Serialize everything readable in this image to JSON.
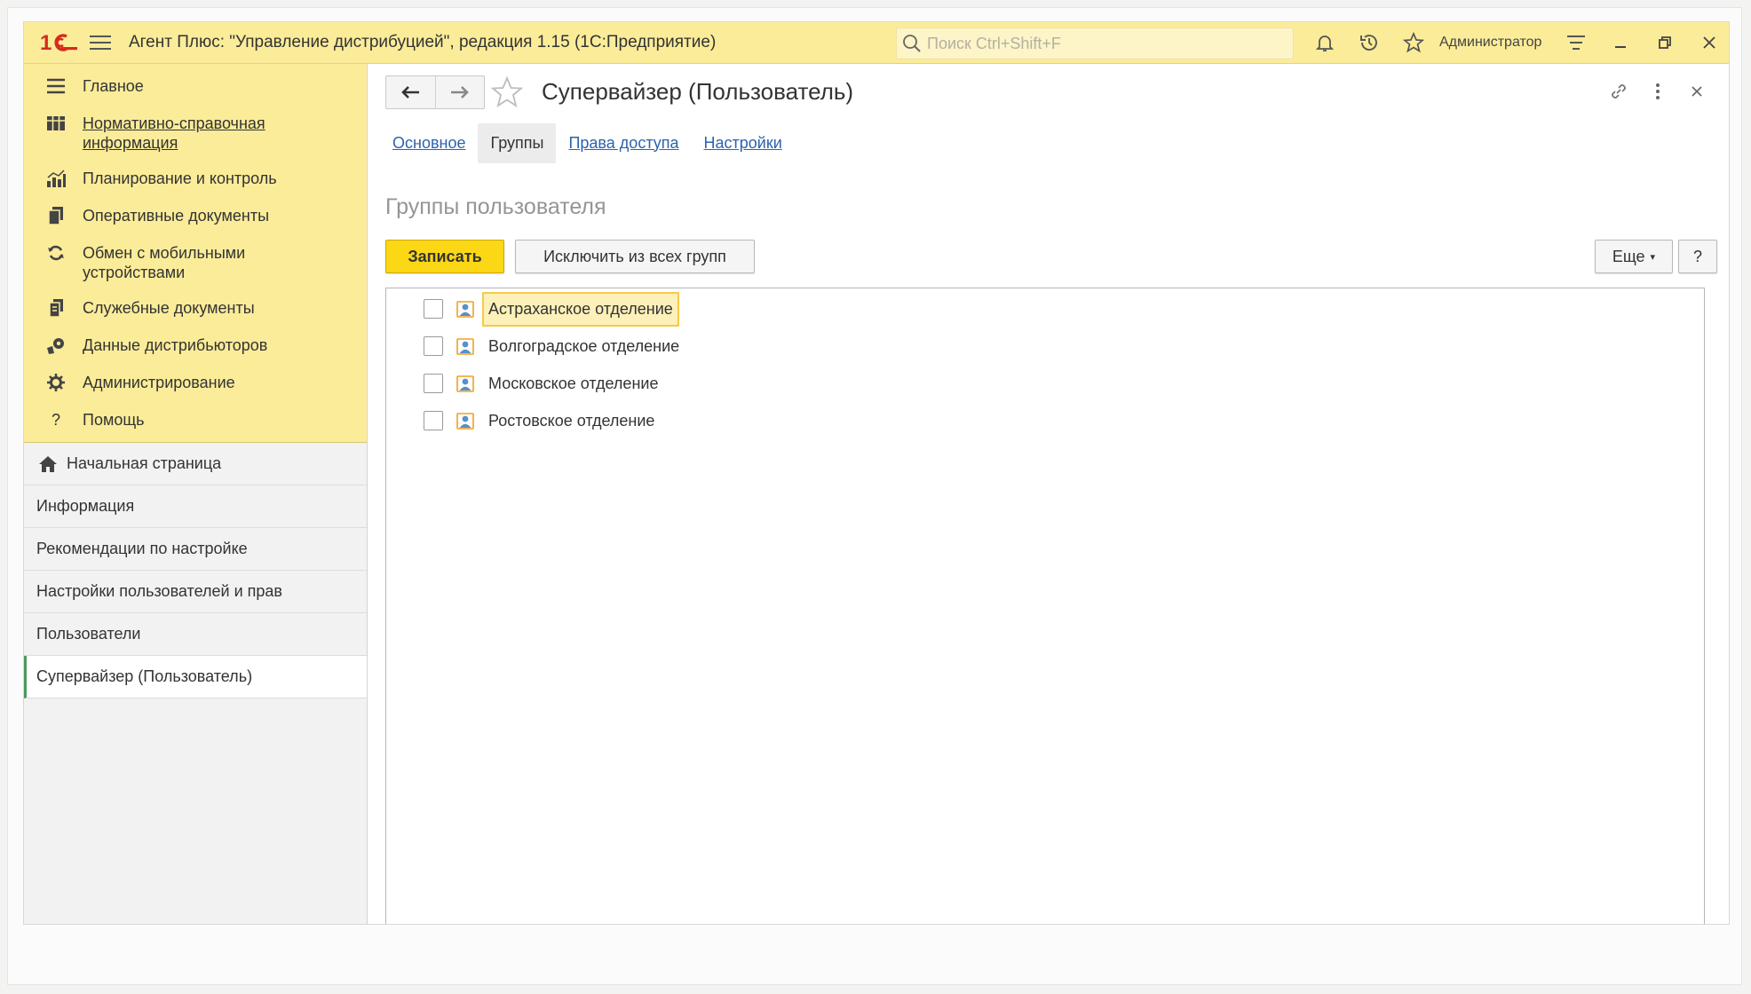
{
  "window": {
    "title": "Агент Плюс: \"Управление дистрибуцией\", редакция 1.15  (1С:Предприятие)",
    "search_placeholder": "Поиск Ctrl+Shift+F",
    "user": "Администратор"
  },
  "sidebar": {
    "sections": [
      {
        "label": "Главное",
        "icon": "hamburger-icon"
      },
      {
        "label": "Нормативно-справочная информация",
        "icon": "grid-icon"
      },
      {
        "label": "Планирование и контроль",
        "icon": "chart-icon"
      },
      {
        "label": "Оперативные документы",
        "icon": "documents-icon"
      },
      {
        "label": "Обмен с мобильными устройствами",
        "icon": "sync-icon"
      },
      {
        "label": "Служебные документы",
        "icon": "service-docs-icon"
      },
      {
        "label": "Данные дистрибьюторов",
        "icon": "distributor-icon"
      },
      {
        "label": "Администрирование",
        "icon": "gear-icon"
      },
      {
        "label": "Помощь",
        "icon": "question-icon"
      }
    ],
    "open_windows": [
      {
        "label": "Начальная страница"
      },
      {
        "label": "Информация"
      },
      {
        "label": "Рекомендации по настройке"
      },
      {
        "label": "Настройки пользователей и прав"
      },
      {
        "label": "Пользователи"
      },
      {
        "label": "Супервайзер (Пользователь)"
      }
    ]
  },
  "form": {
    "title": "Супервайзер (Пользователь)",
    "tabs": [
      {
        "label": "Основное"
      },
      {
        "label": "Группы"
      },
      {
        "label": "Права доступа"
      },
      {
        "label": "Настройки"
      }
    ],
    "active_tab": "Группы",
    "heading": "Группы пользователя",
    "buttons": {
      "save": "Записать",
      "exclude": "Исключить из всех групп",
      "more": "Еще",
      "help": "?"
    },
    "groups": [
      {
        "name": "Астраханское отделение",
        "checked": false
      },
      {
        "name": "Волгоградское отделение",
        "checked": false
      },
      {
        "name": "Московское отделение",
        "checked": false
      },
      {
        "name": "Ростовское отделение",
        "checked": false
      }
    ]
  },
  "colors": {
    "accent_yellow": "#fbec99",
    "button_primary": "#fbd715",
    "link": "#2b63b0",
    "active_marker": "#4a9a5a"
  }
}
